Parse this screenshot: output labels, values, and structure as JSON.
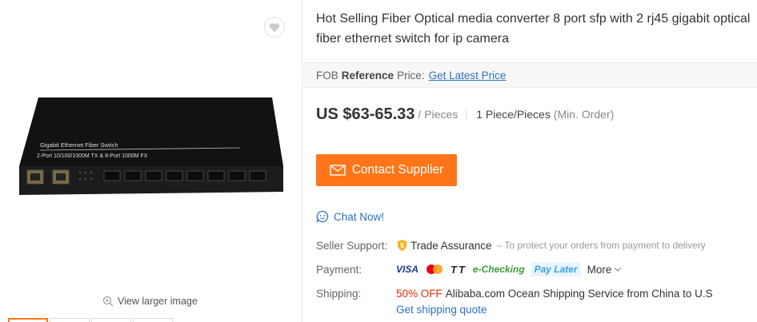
{
  "product": {
    "title": "Hot Selling Fiber Optical media converter 8 port sfp with 2 rj45 gigabit optical fiber ethernet switch for ip camera",
    "image_label_line1": "Gigabit Ethernet Fiber Switch",
    "image_label_line2": "2-Port 10/100/1000M TX & 8-Port 1000M FX",
    "view_larger": "View larger image"
  },
  "reference": {
    "prefix": "FOB",
    "bold": "Reference",
    "suffix": "Price:",
    "link": "Get Latest Price"
  },
  "pricing": {
    "price": "US $63-65.33",
    "unit": "/ Pieces",
    "moq": "1 Piece/Pieces",
    "moq_note": "(Min. Order)"
  },
  "actions": {
    "contact": "Contact Supplier",
    "chat": "Chat Now!"
  },
  "seller_support": {
    "label": "Seller Support:",
    "value": "Trade Assurance",
    "note": "– To protect your orders from payment to delivery"
  },
  "payment": {
    "label": "Payment:",
    "methods": [
      "VISA",
      "mastercard",
      "TT",
      "e-Checking",
      "Pay Later"
    ],
    "visa": "VISA",
    "tt": "TT",
    "echecking": "e-Checking",
    "paylater": "Pay Later",
    "more": "More"
  },
  "shipping": {
    "label": "Shipping:",
    "discount": "50% OFF",
    "text": "Alibaba.com Ocean Shipping Service from China to U.S",
    "quote": "Get shipping quote"
  },
  "colors": {
    "accent": "#ff7519",
    "link": "#2c71c0",
    "discount": "#e62e04"
  }
}
